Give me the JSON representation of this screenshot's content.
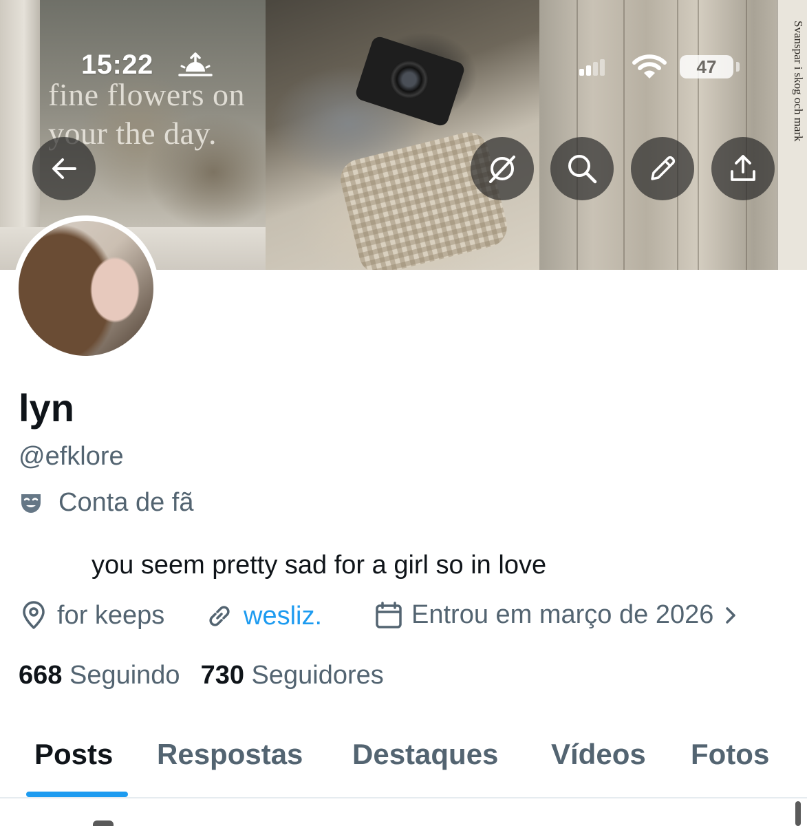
{
  "status_bar": {
    "time": "15:22",
    "battery": "47"
  },
  "banner": {
    "window_text": "fine flowers on your the day.",
    "book_spine": "Svanspar i skog och mark"
  },
  "header_buttons": [
    {
      "name": "back",
      "icon": "arrow-left-icon"
    },
    {
      "name": "grok",
      "icon": "grok-icon"
    },
    {
      "name": "search",
      "icon": "search-icon"
    },
    {
      "name": "edit",
      "icon": "pencil-icon"
    },
    {
      "name": "share",
      "icon": "share-icon"
    }
  ],
  "profile": {
    "display_name": "lyn",
    "handle": "@efklore",
    "category": "Conta de fã",
    "bio": "you seem pretty sad for a girl so in love",
    "location": "for keeps",
    "website": "wesliz.",
    "joined": "Entrou em março de 2026",
    "following_count": "668",
    "following_label": "Seguindo",
    "followers_count": "730",
    "followers_label": "Seguidores"
  },
  "tabs": [
    {
      "label": "Posts",
      "active": true
    },
    {
      "label": "Respostas",
      "active": false
    },
    {
      "label": "Destaques",
      "active": false
    },
    {
      "label": "Vídeos",
      "active": false
    },
    {
      "label": "Fotos",
      "active": false
    }
  ],
  "colors": {
    "accent": "#1d9bf0",
    "text_primary": "#0f1419",
    "text_secondary": "#536471"
  }
}
